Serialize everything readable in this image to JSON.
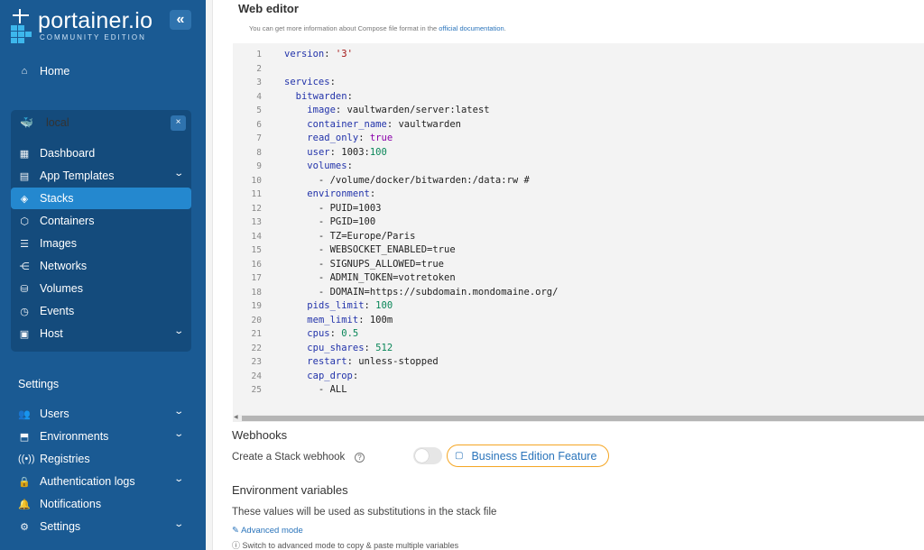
{
  "logo": {
    "title": "portainer.io",
    "subtitle": "COMMUNITY EDITION"
  },
  "sidebar": {
    "collapse_glyph": "«",
    "home": "Home",
    "environment": {
      "name": "local",
      "close_glyph": "×"
    },
    "env_items": [
      {
        "label": "Dashboard",
        "icon": "dashboard-icon"
      },
      {
        "label": "App Templates",
        "icon": "templates-icon",
        "expandable": true
      },
      {
        "label": "Stacks",
        "icon": "stacks-icon",
        "active": true
      },
      {
        "label": "Containers",
        "icon": "containers-icon"
      },
      {
        "label": "Images",
        "icon": "images-icon"
      },
      {
        "label": "Networks",
        "icon": "networks-icon"
      },
      {
        "label": "Volumes",
        "icon": "volumes-icon"
      },
      {
        "label": "Events",
        "icon": "events-icon"
      },
      {
        "label": "Host",
        "icon": "host-icon",
        "expandable": true
      }
    ],
    "settings_heading": "Settings",
    "settings_items": [
      {
        "label": "Users",
        "icon": "users-icon",
        "expandable": true
      },
      {
        "label": "Environments",
        "icon": "environments-icon",
        "expandable": true
      },
      {
        "label": "Registries",
        "icon": "registries-icon"
      },
      {
        "label": "Authentication logs",
        "icon": "auth-logs-icon",
        "expandable": true
      },
      {
        "label": "Notifications",
        "icon": "bell-icon"
      },
      {
        "label": "Settings",
        "icon": "gear-icon",
        "expandable": true
      }
    ]
  },
  "editor": {
    "title": "Web editor",
    "hint_prefix": "You can get more information about Compose file format in the ",
    "hint_link": "official documentation",
    "hint_suffix": ".",
    "lines": [
      "version: '3'",
      "",
      "services:",
      "  bitwarden:",
      "    image: vaultwarden/server:latest",
      "    container_name: vaultwarden",
      "    read_only: true",
      "    user: 1003:100",
      "    volumes:",
      "      - /volume/docker/bitwarden:/data:rw #",
      "    environment:",
      "      - PUID=1003",
      "      - PGID=100",
      "      - TZ=Europe/Paris",
      "      - WEBSOCKET_ENABLED=true",
      "      - SIGNUPS_ALLOWED=true",
      "      - ADMIN_TOKEN=votretoken",
      "      - DOMAIN=https://subdomain.mondomaine.org/",
      "    pids_limit: 100",
      "    mem_limit: 100m",
      "    cpus: 0.5",
      "    cpu_shares: 512",
      "    restart: unless-stopped",
      "    cap_drop:",
      "      - ALL"
    ]
  },
  "webhooks": {
    "title": "Webhooks",
    "label": "Create a Stack webhook",
    "help_glyph": "?",
    "badge": "Business Edition Feature"
  },
  "env_vars": {
    "title": "Environment variables",
    "description": "These values will be used as substitutions in the stack file",
    "advanced_link": "Advanced mode",
    "advanced_hint": "Switch to advanced mode to copy & paste multiple variables"
  },
  "colors": {
    "sidebar": "#1a5a93",
    "active": "#2488cf",
    "link": "#2a74bb",
    "badge_border": "#f5a623"
  }
}
